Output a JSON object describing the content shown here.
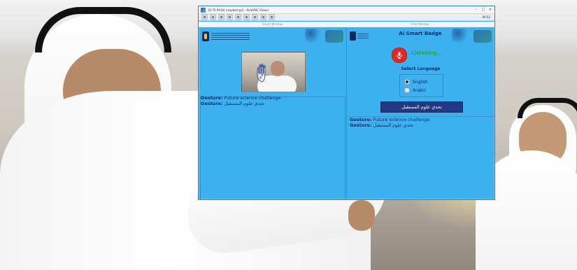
{
  "window": {
    "title": "10.70.99.84 (raspberrypi) - RealVNC Viewer",
    "toolbar_time": "00:52",
    "left_subtitle": "Smart Window",
    "right_subtitle": "Chat Window"
  },
  "left_panel": {
    "gesture_line_1_label": "Gesture:",
    "gesture_line_1_text": "Future science challenge",
    "gesture_line_2_label": "Gesture:",
    "gesture_line_2_text": "تحدي علوم المستقبل"
  },
  "right_panel": {
    "title": "Ai Smart Badge",
    "listening_text": "Listening...",
    "language_title": "Select Language",
    "languages": [
      {
        "label": "English",
        "selected": true
      },
      {
        "label": "Arabic",
        "selected": false
      }
    ],
    "arabic_button_text": "تحدي علوم المستقبل",
    "gesture_line_1_label": "Gesture:",
    "gesture_line_1_text": "Future science challenge",
    "gesture_line_2_label": "Gesture:",
    "gesture_line_2_text": "تحدي علوم المستقبل"
  },
  "icons": {
    "mic": "mic-icon",
    "camera_hand": "hand-landmarks-icon"
  },
  "colors": {
    "app_background": "#3db0ef",
    "listening": "#1fb21f",
    "mic": "#e32727",
    "button": "#223a86",
    "text_primary": "#0c2a6b"
  }
}
